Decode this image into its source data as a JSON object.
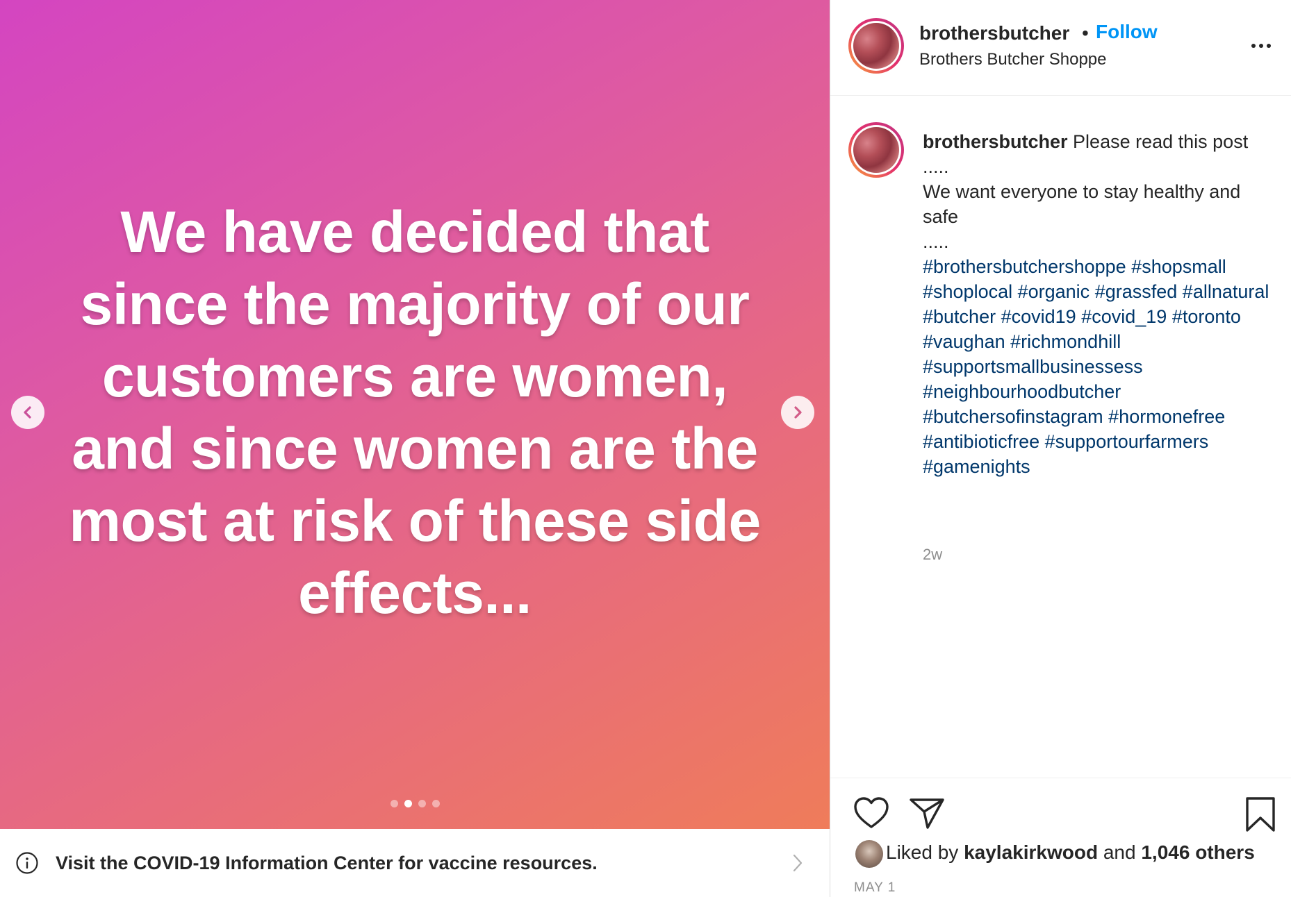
{
  "media": {
    "text": "We have decided that\nsince the majority of our\ncustomers are women,\nand since women are the\nmost at risk of these side\neffects...",
    "slide_count": 4,
    "active_slide": 2
  },
  "covid_banner": {
    "text": "Visit the COVID-19 Information Center for vaccine resources."
  },
  "header": {
    "username": "brothersbutcher",
    "separator": "•",
    "follow_label": "Follow",
    "location": "Brothers Butcher Shoppe"
  },
  "caption": {
    "username": "brothersbutcher",
    "line1": "Please read this post",
    "line2": ".....",
    "line3": "We want everyone to stay healthy and safe",
    "line4": ".....",
    "hashtags": [
      "#brothersbutchershoppe",
      "#shopsmall",
      "#shoplocal",
      "#organic",
      "#grassfed",
      "#allnatural",
      "#butcher",
      "#covid19",
      "#covid_19",
      "#toronto",
      "#vaughan",
      "#richmondhill",
      "#supportsmallbusinessess",
      "#neighbourhoodbutcher",
      "#butchersofinstagram",
      "#hormonefree",
      "#antibioticfree",
      "#supportourfarmers",
      "#gamenights"
    ],
    "age": "2w"
  },
  "likes": {
    "prefix": "Liked by",
    "user": "kaylakirkwood",
    "middle": "and",
    "others": "1,046 others"
  },
  "date": "MAY 1",
  "colors": {
    "follow_blue": "#0095f6",
    "hashtag_blue": "#00376b",
    "gradient_start": "#d445c1",
    "gradient_end": "#ef7c5a"
  }
}
